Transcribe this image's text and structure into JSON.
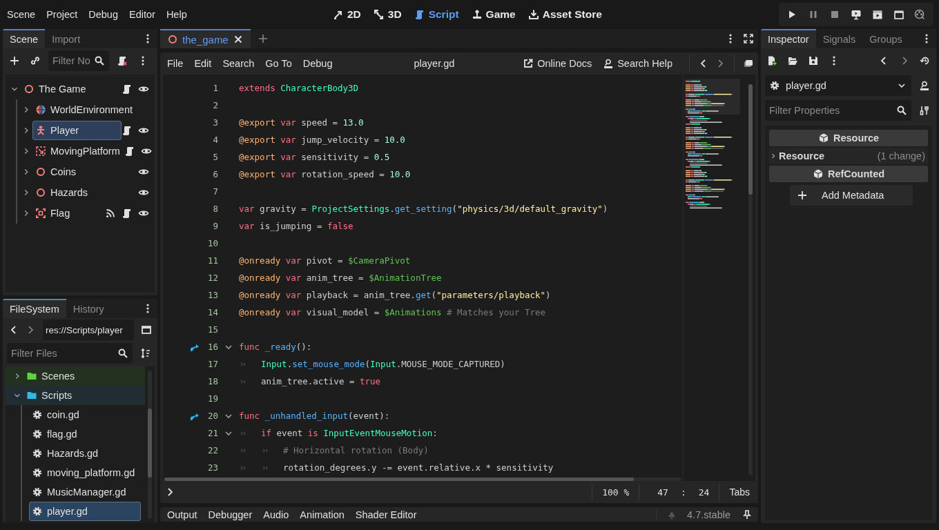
{
  "menu": [
    "Scene",
    "Project",
    "Debug",
    "Editor",
    "Help"
  ],
  "workspaces": [
    {
      "label": "2D",
      "kind": "flat",
      "selected": false
    },
    {
      "label": "3D",
      "kind": "spatial",
      "selected": false
    },
    {
      "label": "Script",
      "kind": "script",
      "selected": true
    },
    {
      "label": "Game",
      "kind": "game",
      "selected": false
    },
    {
      "label": "Asset Store",
      "kind": "store",
      "selected": false
    }
  ],
  "run_bar": [
    {
      "kind": "play"
    },
    {
      "kind": "pause"
    },
    {
      "kind": "stop"
    },
    {
      "kind": "remote"
    },
    {
      "kind": "scene"
    },
    {
      "kind": "custom"
    },
    {
      "kind": "movie"
    }
  ],
  "scene_dock": {
    "tabs": [
      {
        "label": "Scene",
        "selected": true
      },
      {
        "label": "Import",
        "selected": false
      }
    ],
    "filter": {
      "placeholder": "Filter No"
    },
    "tree": [
      {
        "name": "The Game",
        "kind": "node",
        "expanded": true,
        "selected": false,
        "signals": false,
        "script": true,
        "visible": true,
        "children": [
          {
            "name": "WorldEnvironment",
            "kind": "world",
            "expanded": false,
            "selected": false,
            "signals": false,
            "script": false,
            "visible": false
          },
          {
            "name": "Player",
            "kind": "character",
            "expanded": false,
            "selected": true,
            "signals": false,
            "script": true,
            "visible": true
          },
          {
            "name": "MovingPlatform",
            "kind": "platform",
            "expanded": false,
            "selected": false,
            "signals": false,
            "script": true,
            "visible": true
          },
          {
            "name": "Coins",
            "kind": "node",
            "expanded": false,
            "selected": false,
            "signals": false,
            "script": false,
            "visible": true
          },
          {
            "name": "Hazards",
            "kind": "node",
            "expanded": false,
            "selected": false,
            "signals": false,
            "script": false,
            "visible": true
          },
          {
            "name": "Flag",
            "kind": "area",
            "expanded": false,
            "selected": false,
            "signals": true,
            "script": true,
            "visible": true
          }
        ]
      }
    ]
  },
  "filesystem": {
    "tabs": [
      {
        "label": "FileSystem",
        "selected": true
      },
      {
        "label": "History",
        "selected": false
      }
    ],
    "path": "res://Scripts/player",
    "filter": {
      "placeholder": "Filter Files"
    },
    "tree": [
      {
        "name": "Scenes",
        "kind": "folder",
        "color": "#5fd33f",
        "expanded": false,
        "selected": false
      },
      {
        "name": "Scripts",
        "kind": "folder",
        "color": "#35b8e0",
        "expanded": true,
        "selected": false,
        "children": [
          {
            "name": "coin.gd",
            "kind": "script",
            "selected": false
          },
          {
            "name": "flag.gd",
            "kind": "script",
            "selected": false
          },
          {
            "name": "Hazards.gd",
            "kind": "script",
            "selected": false
          },
          {
            "name": "moving_platform.gd",
            "kind": "script",
            "selected": false
          },
          {
            "name": "MusicManager.gd",
            "kind": "script",
            "selected": false
          },
          {
            "name": "player.gd",
            "kind": "script",
            "selected": true
          }
        ]
      }
    ]
  },
  "scene_tabs": [
    {
      "label": "the_game",
      "selected": true
    }
  ],
  "script_editor": {
    "menu": [
      "File",
      "Edit",
      "Search",
      "Go To",
      "Debug"
    ],
    "file_title": "player.gd",
    "help_links": [
      {
        "label": "Online Docs",
        "kind": "external"
      },
      {
        "label": "Search Help",
        "kind": "doc"
      }
    ],
    "lines": [
      {
        "n": "1",
        "fold": false,
        "override": false,
        "tokens": [
          {
            "kind": "keyword",
            "text": "extends "
          },
          {
            "kind": "type",
            "text": "CharacterBody3D"
          }
        ]
      },
      {
        "n": "2",
        "fold": false,
        "override": false
      },
      {
        "n": "3",
        "fold": false,
        "override": false,
        "tokens": [
          {
            "kind": "annotation",
            "text": "@export "
          },
          {
            "kind": "keyword",
            "text": "var "
          },
          {
            "kind": "plain",
            "text": "speed = "
          },
          {
            "kind": "number",
            "text": "13.0"
          }
        ]
      },
      {
        "n": "4",
        "fold": false,
        "override": false,
        "tokens": [
          {
            "kind": "annotation",
            "text": "@export "
          },
          {
            "kind": "keyword",
            "text": "var "
          },
          {
            "kind": "plain",
            "text": "jump_velocity = "
          },
          {
            "kind": "number",
            "text": "10.0"
          }
        ]
      },
      {
        "n": "5",
        "fold": false,
        "override": false,
        "tokens": [
          {
            "kind": "annotation",
            "text": "@export "
          },
          {
            "kind": "keyword",
            "text": "var "
          },
          {
            "kind": "plain",
            "text": "sensitivity = "
          },
          {
            "kind": "number",
            "text": "0.5"
          }
        ]
      },
      {
        "n": "6",
        "fold": false,
        "override": false,
        "tokens": [
          {
            "kind": "annotation",
            "text": "@export "
          },
          {
            "kind": "keyword",
            "text": "var "
          },
          {
            "kind": "plain",
            "text": "rotation_speed = "
          },
          {
            "kind": "number",
            "text": "10.0"
          }
        ]
      },
      {
        "n": "7",
        "fold": false,
        "override": false
      },
      {
        "n": "8",
        "fold": false,
        "override": false,
        "tokens": [
          {
            "kind": "keyword",
            "text": "var "
          },
          {
            "kind": "plain",
            "text": "gravity = "
          },
          {
            "kind": "type",
            "text": "ProjectSettings"
          },
          {
            "kind": "plain",
            "text": "."
          },
          {
            "kind": "function",
            "text": "get_setting"
          },
          {
            "kind": "plain",
            "text": "("
          },
          {
            "kind": "string",
            "text": "\"physics/3d/default_gravity\""
          },
          {
            "kind": "plain",
            "text": ")"
          }
        ]
      },
      {
        "n": "9",
        "fold": false,
        "override": false,
        "tokens": [
          {
            "kind": "keyword",
            "text": "var "
          },
          {
            "kind": "plain",
            "text": "is_jumping = "
          },
          {
            "kind": "keyword",
            "text": "false"
          }
        ]
      },
      {
        "n": "10",
        "fold": false,
        "override": false
      },
      {
        "n": "11",
        "fold": false,
        "override": false,
        "tokens": [
          {
            "kind": "annotation",
            "text": "@onready "
          },
          {
            "kind": "keyword",
            "text": "var "
          },
          {
            "kind": "plain",
            "text": "pivot = "
          },
          {
            "kind": "nodepath",
            "text": "$CameraPivot"
          }
        ]
      },
      {
        "n": "12",
        "fold": false,
        "override": false,
        "tokens": [
          {
            "kind": "annotation",
            "text": "@onready "
          },
          {
            "kind": "keyword",
            "text": "var "
          },
          {
            "kind": "plain",
            "text": "anim_tree = "
          },
          {
            "kind": "nodepath",
            "text": "$AnimationTree"
          }
        ]
      },
      {
        "n": "13",
        "fold": false,
        "override": false,
        "tokens": [
          {
            "kind": "annotation",
            "text": "@onready "
          },
          {
            "kind": "keyword",
            "text": "var "
          },
          {
            "kind": "plain",
            "text": "playback = anim_tree."
          },
          {
            "kind": "function",
            "text": "get"
          },
          {
            "kind": "plain",
            "text": "("
          },
          {
            "kind": "string",
            "text": "\"parameters/playback\""
          },
          {
            "kind": "plain",
            "text": ")"
          }
        ]
      },
      {
        "n": "14",
        "fold": false,
        "override": false,
        "tokens": [
          {
            "kind": "annotation",
            "text": "@onready "
          },
          {
            "kind": "keyword",
            "text": "var "
          },
          {
            "kind": "plain",
            "text": "visual_model = "
          },
          {
            "kind": "nodepath",
            "text": "$Animations "
          },
          {
            "kind": "comment",
            "text": "# Matches your Tree"
          }
        ]
      },
      {
        "n": "15",
        "fold": false,
        "override": false
      },
      {
        "n": "16",
        "fold": true,
        "override": true,
        "tokens": [
          {
            "kind": "keyword",
            "text": "func "
          },
          {
            "kind": "function",
            "text": "_ready"
          },
          {
            "kind": "plain",
            "text": "():"
          }
        ]
      },
      {
        "n": "17",
        "fold": false,
        "override": false,
        "tokens": [
          {
            "kind": "tab"
          },
          {
            "kind": "type",
            "text": "Input"
          },
          {
            "kind": "plain",
            "text": "."
          },
          {
            "kind": "function",
            "text": "set_mouse_mode"
          },
          {
            "kind": "plain",
            "text": "("
          },
          {
            "kind": "type",
            "text": "Input"
          },
          {
            "kind": "plain",
            "text": ".MOUSE_MODE_CAPTURED)"
          }
        ]
      },
      {
        "n": "18",
        "fold": false,
        "override": false,
        "tokens": [
          {
            "kind": "tab"
          },
          {
            "kind": "plain",
            "text": "anim_tree.active = "
          },
          {
            "kind": "keyword",
            "text": "true"
          }
        ]
      },
      {
        "n": "19",
        "fold": false,
        "override": false
      },
      {
        "n": "20",
        "fold": true,
        "override": true,
        "tokens": [
          {
            "kind": "keyword",
            "text": "func "
          },
          {
            "kind": "function",
            "text": "_unhandled_input"
          },
          {
            "kind": "plain",
            "text": "(event):"
          }
        ]
      },
      {
        "n": "21",
        "fold": true,
        "override": false,
        "tokens": [
          {
            "kind": "tab"
          },
          {
            "kind": "keyword",
            "text": "if "
          },
          {
            "kind": "plain",
            "text": "event "
          },
          {
            "kind": "keyword",
            "text": "is "
          },
          {
            "kind": "type",
            "text": "InputEventMouseMotion"
          },
          {
            "kind": "plain",
            "text": ":"
          }
        ]
      },
      {
        "n": "22",
        "fold": false,
        "override": false,
        "tokens": [
          {
            "kind": "tab"
          },
          {
            "kind": "tab"
          },
          {
            "kind": "comment",
            "text": "# Horizontal rotation (Body)"
          }
        ]
      },
      {
        "n": "23",
        "fold": false,
        "override": false,
        "tokens": [
          {
            "kind": "tab"
          },
          {
            "kind": "tab"
          },
          {
            "kind": "plain",
            "text": "rotation_degrees.y -= event.relative.x * sensitivity"
          }
        ]
      }
    ],
    "status": {
      "zoom": "100 %",
      "line": "47",
      "separator": ":",
      "column": "24",
      "indent": "Tabs"
    }
  },
  "bottom_tabs": [
    "Output",
    "Debugger",
    "Audio",
    "Animation",
    "Shader Editor"
  ],
  "version": "4.7.stable",
  "inspector": {
    "tabs": [
      {
        "label": "Inspector",
        "selected": true
      },
      {
        "label": "Signals",
        "selected": false
      },
      {
        "label": "Groups",
        "selected": false
      }
    ],
    "resource": "player.gd",
    "filter": {
      "placeholder": "Filter Properties"
    },
    "sections": [
      {
        "kind": "category",
        "label": "Resource"
      },
      {
        "kind": "group",
        "label": "Resource",
        "note": "(1 change)",
        "expanded": false
      },
      {
        "kind": "category",
        "label": "RefCounted"
      },
      {
        "kind": "button",
        "label": "Add Metadata"
      }
    ]
  }
}
